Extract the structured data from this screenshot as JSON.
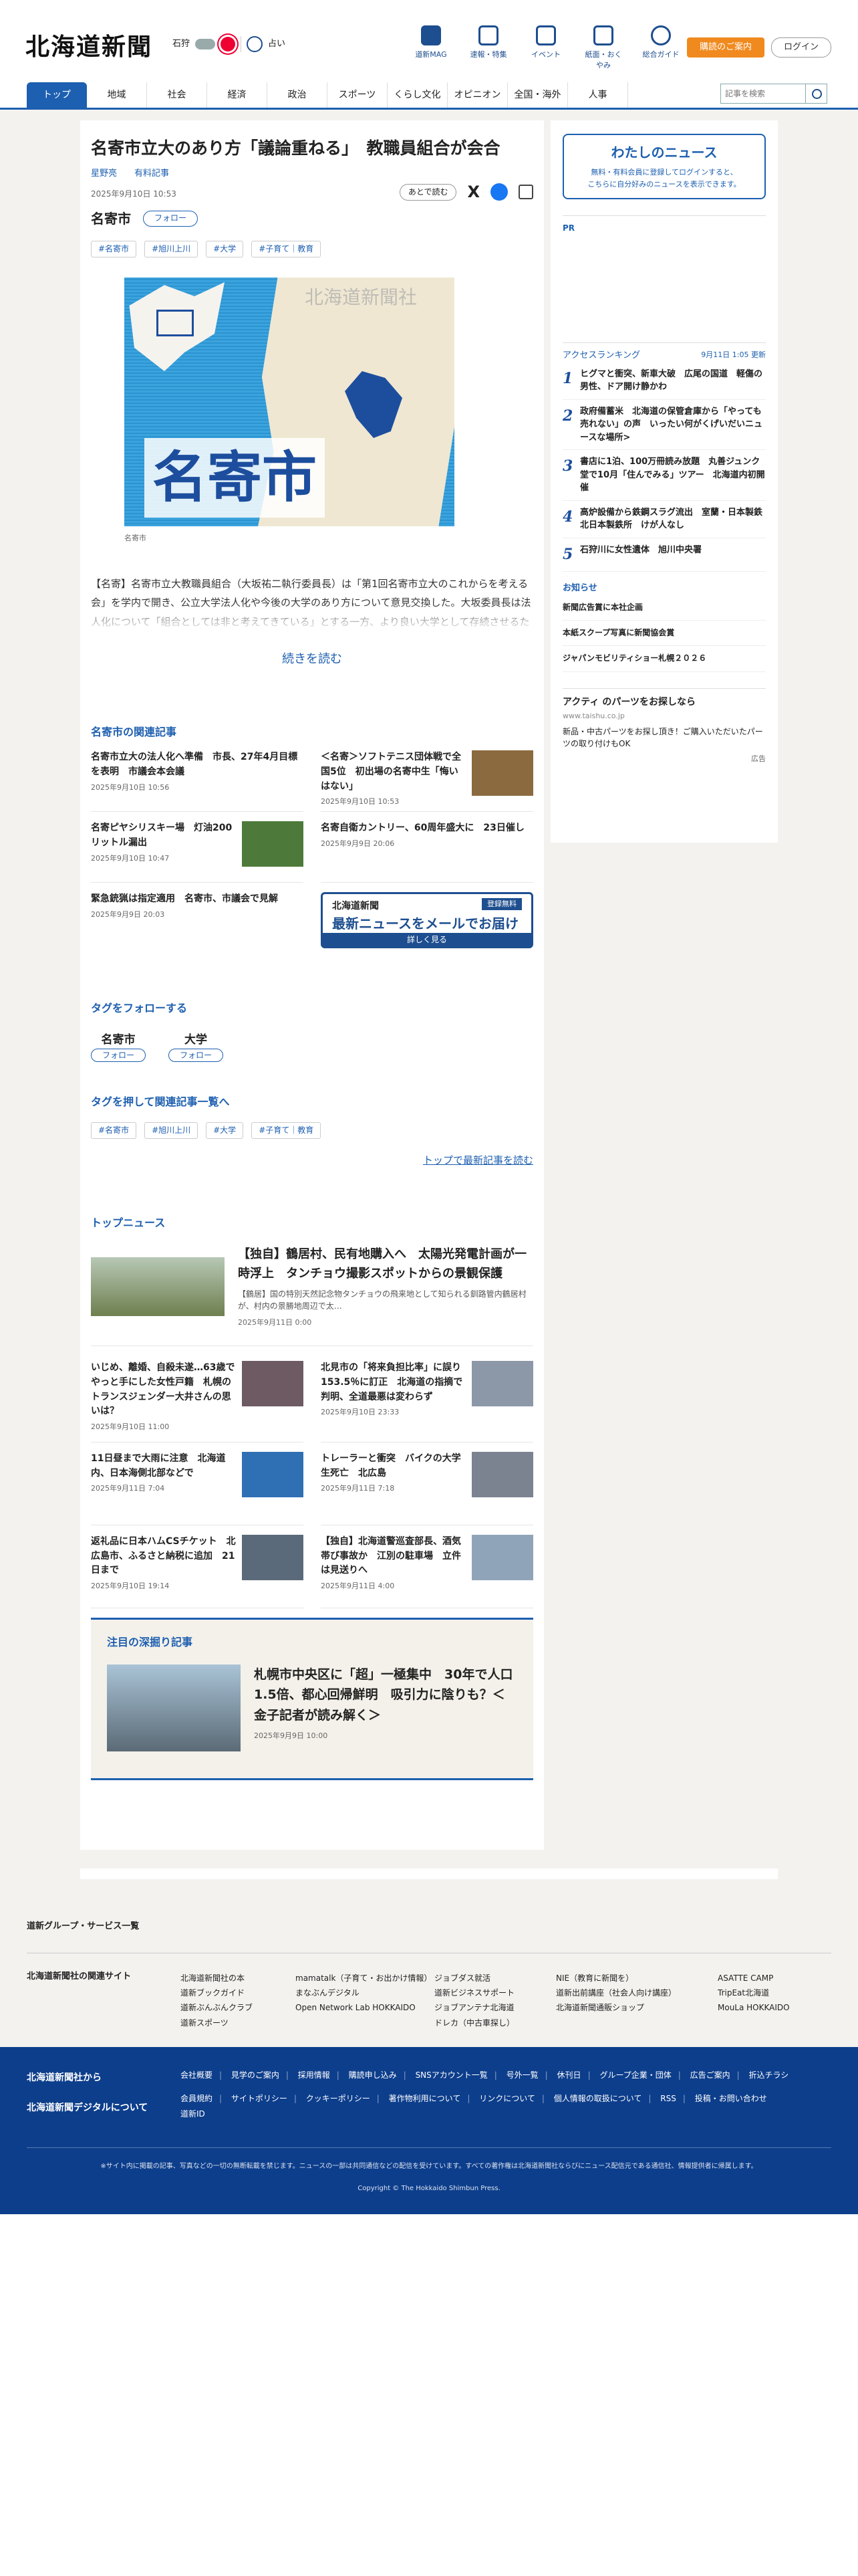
{
  "header": {
    "logo": "北海道新聞",
    "weather": {
      "place": "石狩",
      "sub": "占い"
    },
    "nav_icons": [
      {
        "label": "道新MAG",
        "icon": "magazine-icon"
      },
      {
        "label": "速報・特集",
        "icon": "flag-icon"
      },
      {
        "label": "イベント",
        "icon": "calendar-icon"
      },
      {
        "label": "紙面・おくやみ",
        "icon": "paper-icon"
      },
      {
        "label": "総合ガイド",
        "icon": "help-icon"
      }
    ],
    "subscribe_label": "購読のご案内",
    "login_label": "ログイン"
  },
  "gnav": {
    "items": [
      "トップ",
      "地域",
      "社会",
      "経済",
      "政治",
      "スポーツ",
      "くらし文化",
      "オピニオン",
      "全国・海外",
      "人事"
    ],
    "search_placeholder": "記事を検索"
  },
  "article": {
    "title": "名寄市立大のあり方「議論重ねる」　教職員組合が会合",
    "author": "星野亮",
    "paid_label": "有料記事",
    "date": "2025年9月10日 10:53",
    "region": "名寄市",
    "follow_label": "フォロー",
    "later_label": "あとで読む",
    "tags": [
      "#名寄市",
      "#旭川上川",
      "#大学",
      "#子育て｜教育"
    ],
    "map": {
      "label": "名寄市",
      "brand": "北海道新聞社"
    },
    "caption": "名寄市",
    "lead": "【名寄】名寄市立大教職員組合（大坂祐二執行委員長）は「第1回名寄市立大のこれからを考える会」を学内で開き、公立大学法人化や今後の大学のあり方について意見交換した。大坂委員長は法人化について「組合としては非と考えてきている」とする一方、より良い大学として存続させるために議論を重ねる考えを示した。…",
    "read_more": "続きを読む"
  },
  "related": {
    "heading": "名寄市の関連記事",
    "items": [
      {
        "title": "名寄市立大の法人化へ準備　市長、27年4月目標を表明　市議会本会議",
        "date": "2025年9月10日 10:56",
        "thumb": false
      },
      {
        "title": "＜名寄＞ソフトテニス団体戦で全国5位　初出場の名寄中生「悔いはない」",
        "date": "2025年9月10日 10:53",
        "thumb": true
      },
      {
        "title": "名寄ピヤシリスキー場　灯油200リットル漏出",
        "date": "2025年9月10日 10:47",
        "thumb": true
      },
      {
        "title": "名寄自衛カントリー、60周年盛大に　23日催し",
        "date": "2025年9月9日 20:06",
        "thumb": false
      },
      {
        "title": "緊急銃猟は指定適用　名寄市、市議会で見解",
        "date": "2025年9月9日 20:03",
        "thumb": false
      }
    ],
    "ad": {
      "brand": "北海道新聞",
      "badge": "登録無料",
      "headline": "最新ニュースをメールでお届け",
      "button": "詳しく見る"
    }
  },
  "follow_tags": {
    "heading": "タグをフォローする",
    "items": [
      {
        "name": "名寄市",
        "button": "フォロー"
      },
      {
        "name": "大学",
        "button": "フォロー"
      }
    ]
  },
  "tag_push": {
    "heading": "タグを押して関連記事一覧へ",
    "tags": [
      "#名寄市",
      "#旭川上川",
      "#大学",
      "#子育て｜教育"
    ],
    "top_link": "トップで最新記事を読む"
  },
  "top_news": {
    "heading": "トップニュース",
    "feature": {
      "title": "【独自】鶴居村、民有地購入へ　太陽光発電計画が一時浮上　タンチョウ撮影スポットからの景観保護",
      "excerpt": "【鶴居】国の特別天然記念物タンチョウの飛来地として知られる釧路管内鶴居村が、村内の景勝地周辺で太…",
      "date": "2025年9月11日 0:00"
    },
    "items": [
      {
        "title": "いじめ、離婚、自殺未遂…63歳でやっと手にした女性戸籍　札幌のトランスジェンダー大井さんの思いは？",
        "date": "2025年9月10日 11:00"
      },
      {
        "title": "北見市の「将来負担比率」に誤り　153.5％に訂正　北海道の指摘で判明、全道最悪は変わらず",
        "date": "2025年9月10日 23:33"
      },
      {
        "title": "11日昼まで大雨に注意　北海道内、日本海側北部などで",
        "date": "2025年9月11日 7:04"
      },
      {
        "title": "トレーラーと衝突　バイクの大学生死亡　北広島",
        "date": "2025年9月11日 7:18"
      },
      {
        "title": "返礼品に日本ハムCSチケット　北広島市、ふるさと納税に追加　21日まで",
        "date": "2025年9月10日 19:14"
      },
      {
        "title": "【独自】北海道警巡査部長、酒気帯び事故か　江別の駐車場　立件は見送りへ",
        "date": "2025年9月11日 4:00"
      }
    ]
  },
  "deep": {
    "heading": "注目の深掘り記事",
    "title": "札幌市中央区に「超」一極集中　30年で人口1.5倍、都心回帰鮮明　吸引力に陰りも？＜金子記者が読み解く＞",
    "date": "2025年9月9日 10:00"
  },
  "sidebar": {
    "mynews": {
      "title": "わたしのニュース",
      "text1": "無料・有料会員に登録してログインすると、",
      "text2": "こちらに自分好みのニュースを表示できます。"
    },
    "pr": "PR",
    "ranking": {
      "title": "アクセスランキング",
      "updated": "9月11日 1:05 更新",
      "items": [
        "ヒグマと衝突、新車大破　広尾の国道　軽傷の男性、ドア開け静かわ",
        "政府備蓄米　北海道の保管倉庫から「やっても売れない」の声　いったい何がくげいだいニュースな場所>",
        "書店に1泊、100万冊読み放題　丸善ジュンク堂で10月「住んでみる」ツアー　北海道内初開催",
        "高炉設備から鉄鋼スラグ流出　室蘭・日本製鉄北日本製鉄所　けが人なし",
        "石狩川に女性遺体　旭川中央署"
      ]
    },
    "notices": {
      "title": "お知らせ",
      "items": [
        "新聞広告賞に本社企画",
        "本紙スクープ写真に新聞協会賞",
        "ジャパンモビリティショー札幌２０２６"
      ]
    },
    "ad": {
      "title": "アクティ のパーツをお探しなら",
      "domain": "www.taishu.co.jp",
      "text": "新品・中古パーツをお探し頂き！ご購入いただいたパーツの取り付けもOK",
      "label": "広告"
    }
  },
  "footer": {
    "group_service": "道新グループ・サービス一覧",
    "sites_heading": "北海道新聞社の関連サイト",
    "sites_cols": [
      [
        "北海道新聞社の本",
        "道新ブックガイド",
        "道新ぶんぶんクラブ",
        "道新スポーツ"
      ],
      [
        "mamatalk（子育て・お出かけ情報）",
        "まなぶんデジタル",
        "Open Network Lab HOKKAIDO"
      ],
      [
        "ジョブダス就活",
        "道新ビジネスサポート",
        "ジョブアンテナ北海道",
        "ドレカ（中古車探し）"
      ],
      [
        "NIE（教育に新聞を）",
        "道新出前講座（社会人向け講座）",
        "北海道新聞通販ショップ"
      ],
      [
        "ASATTE CAMP",
        "TripEat北海道",
        "MouLa HOKKAIDO"
      ]
    ],
    "left1": "北海道新聞社から",
    "left2": "北海道新聞デジタルについて",
    "links1": [
      "会社概要",
      "見学のご案内",
      "採用情報",
      "購読申し込み",
      "SNSアカウント一覧",
      "号外一覧",
      "休刊日",
      "グループ企業・団体",
      "広告ご案内",
      "折込チラシ"
    ],
    "links2": [
      "会員規約",
      "サイトポリシー",
      "クッキーポリシー",
      "著作物利用について",
      "リンクについて",
      "個人情報の取扱について",
      "RSS",
      "投稿・お問い合わせ",
      "道新ID"
    ],
    "disclaimer": "※サイト内に掲載の記事、写真などの一切の無断転載を禁じます。ニュースの一部は共同通信などの配信を受けています。すべての著作権は北海道新聞社ならびにニュース配信元である通信社、情報提供者に帰属します。",
    "copyright": "Copyright © The Hokkaido Shimbun Press."
  }
}
